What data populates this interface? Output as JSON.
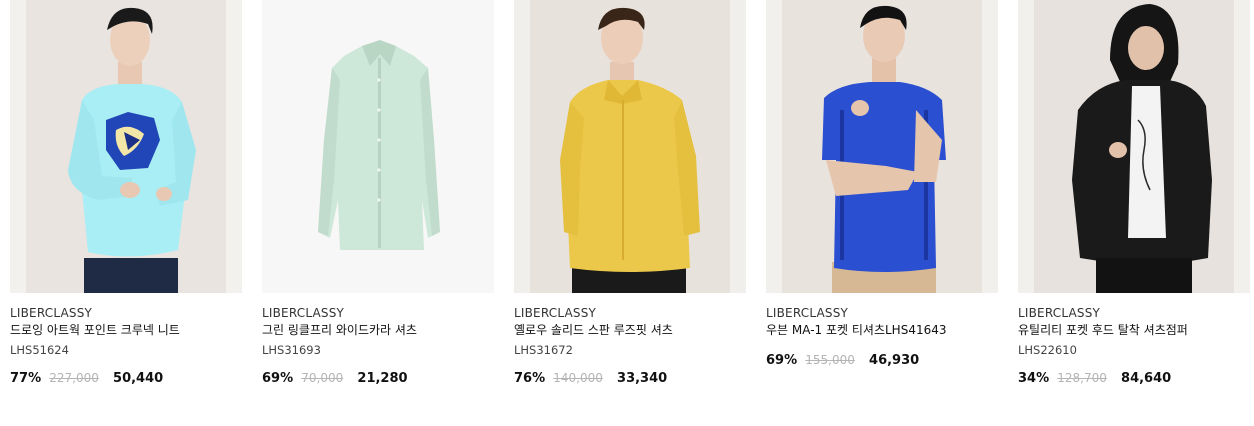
{
  "products": [
    {
      "brand": "LIBERCLASSY",
      "name": "드로잉 아트웍 포인트 크루넥 니트",
      "code": "LHS51624",
      "discount": "77%",
      "original_price": "227,000",
      "sale_price": "50,440",
      "image_alt": "light blue crew-neck knit with drawing artwork"
    },
    {
      "brand": "LIBERCLASSY",
      "name": "그린 링클프리 와이드카라 셔츠",
      "code": "LHS31693",
      "discount": "69%",
      "original_price": "70,000",
      "sale_price": "21,280",
      "image_alt": "mint green wide collar shirt flat lay"
    },
    {
      "brand": "LIBERCLASSY",
      "name": "옐로우 솔리드 스판 루즈핏 셔츠",
      "code": "LHS31672",
      "discount": "76%",
      "original_price": "140,000",
      "sale_price": "33,340",
      "image_alt": "yellow loose fit shirt"
    },
    {
      "brand": "LIBERCLASSY",
      "name": "우븐 MA-1 포켓 티셔츠LHS41643",
      "code": "",
      "discount": "69%",
      "original_price": "155,000",
      "sale_price": "46,930",
      "image_alt": "blue woven MA-1 pocket t-shirt"
    },
    {
      "brand": "LIBERCLASSY",
      "name": "유틸리티 포켓 후드 탈착 셔츠점퍼",
      "code": "LHS22610",
      "discount": "34%",
      "original_price": "128,700",
      "sale_price": "84,640",
      "image_alt": "black hooded shirt jumper"
    }
  ],
  "colors": {
    "discount": "#111111",
    "strike": "#b5b5b5",
    "price": "#111111"
  }
}
